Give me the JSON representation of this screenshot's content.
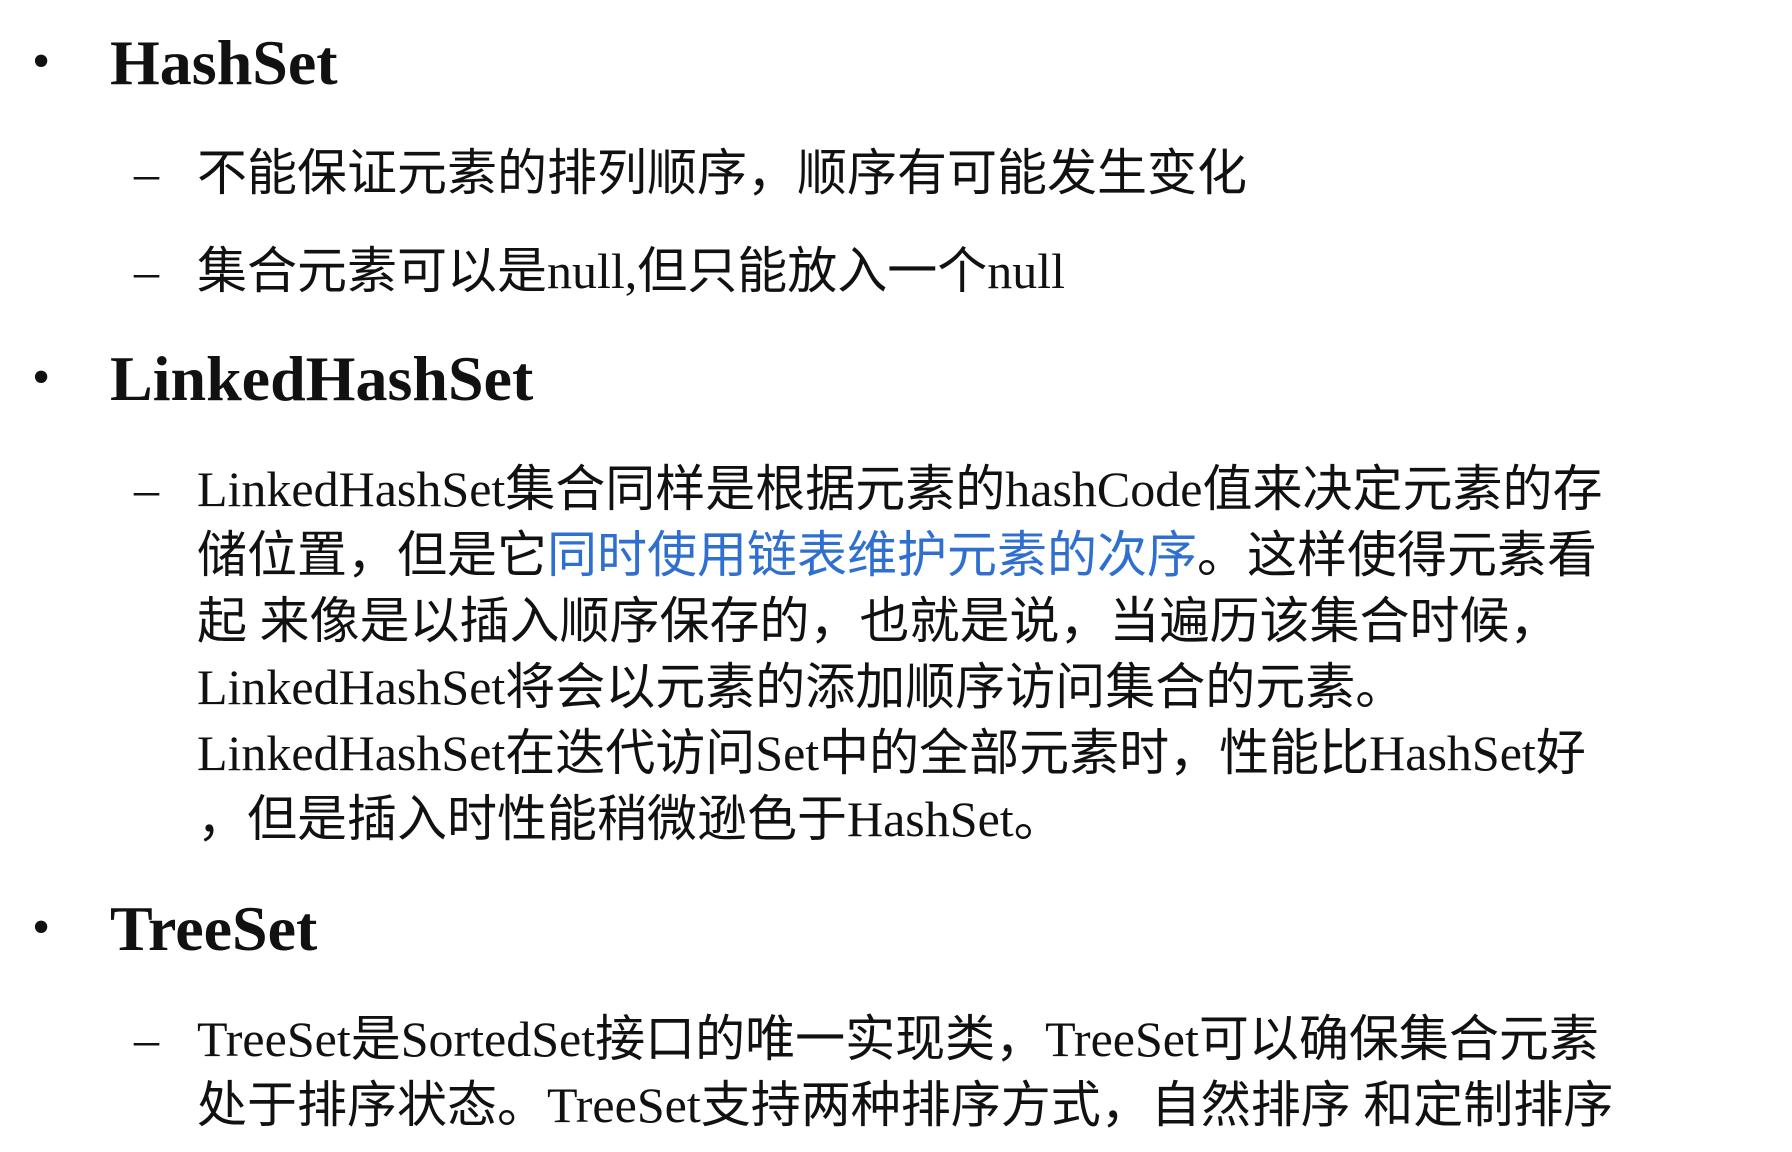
{
  "sections": [
    {
      "heading": "HashSet",
      "items": [
        {
          "lines": [
            "不能保证元素的排列顺序，顺序有可能发生变化"
          ]
        },
        {
          "lines": [
            "集合元素可以是null,但只能放入一个null"
          ]
        }
      ]
    },
    {
      "heading": "LinkedHashSet",
      "items": [
        {
          "lines": [
            "LinkedHashSet集合同样是根据元素的hashCode值来决定元素的存",
            "储位置，但是它",
            "同时使用链表维护元素的次序",
            "。这样使得元素看",
            "起 来像是以插入顺序保存的，也就是说，当遍历该集合时候，",
            "LinkedHashSet将会以元素的添加顺序访问集合的元素。",
            "LinkedHashSet在迭代访问Set中的全部元素时，性能比HashSet好",
            "，但是插入时性能稍微逊色于HashSet。"
          ]
        }
      ]
    },
    {
      "heading": "TreeSet",
      "items": [
        {
          "lines": [
            "TreeSet是SortedSet接口的唯一实现类，TreeSet可以确保集合元素",
            "处于排序状态。TreeSet支持两种排序方式，自然排序 和定制排序"
          ]
        }
      ]
    }
  ],
  "bullet_glyph": "•",
  "dash_glyph": "–",
  "colors": {
    "text": "#111111",
    "highlight": "#2f6fd0",
    "background": "#ffffff"
  }
}
